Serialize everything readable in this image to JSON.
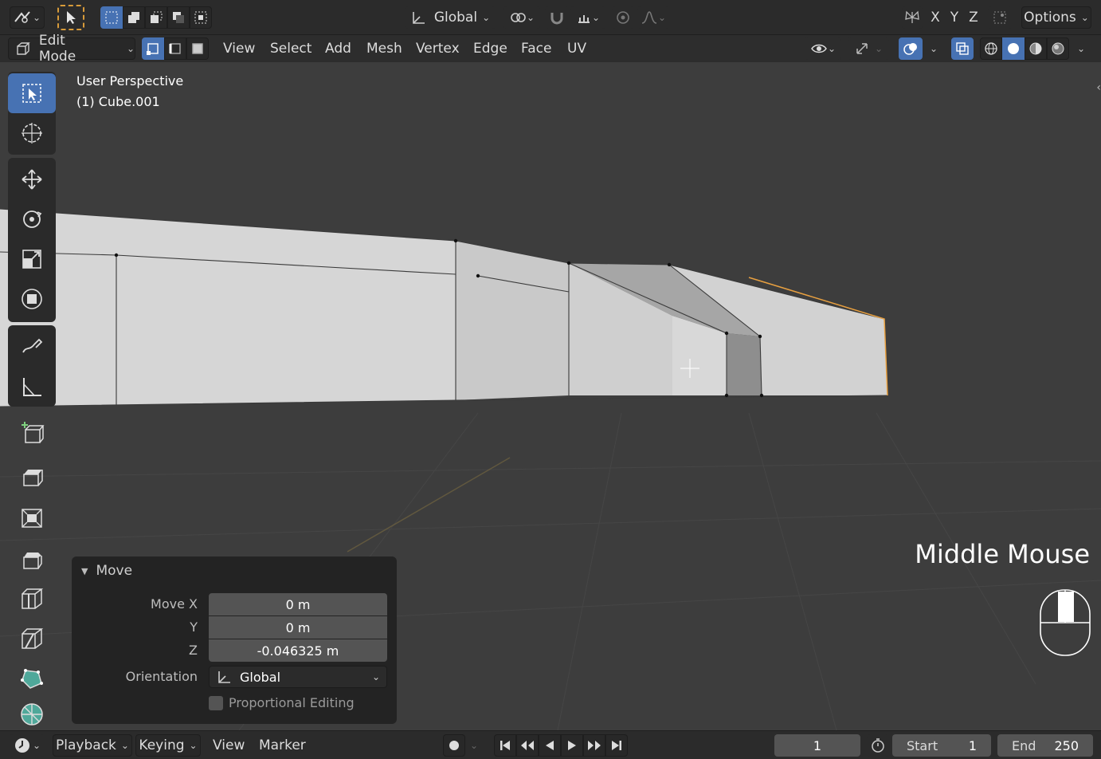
{
  "topbar": {
    "orientation_label": "Global",
    "axes": [
      "X",
      "Y",
      "Z"
    ],
    "options_label": "Options"
  },
  "header": {
    "mode_label": "Edit Mode",
    "menus": [
      "View",
      "Select",
      "Add",
      "Mesh",
      "Vertex",
      "Edge",
      "Face",
      "UV"
    ]
  },
  "viewport": {
    "perspective_label": "User Perspective",
    "object_label": "(1) Cube.001",
    "overlay_hint": "Middle Mouse"
  },
  "redo_panel": {
    "title": "Move",
    "move_x_label": "Move X",
    "move_x_value": "0 m",
    "y_label": "Y",
    "y_value": "0 m",
    "z_label": "Z",
    "z_value": "-0.046325 m",
    "orientation_label": "Orientation",
    "orientation_value": "Global",
    "proportional_label": "Proportional Editing",
    "proportional_checked": false
  },
  "timeline": {
    "menus": [
      "Playback",
      "Keying",
      "View",
      "Marker"
    ],
    "current_frame": "1",
    "start_label": "Start",
    "start_value": "1",
    "end_label": "End",
    "end_value": "250"
  },
  "colors": {
    "accent": "#4772b3",
    "viewport_bg": "#3d3d3d",
    "mesh_face": "#d4d4d4",
    "selected_edge": "#e8a040"
  }
}
